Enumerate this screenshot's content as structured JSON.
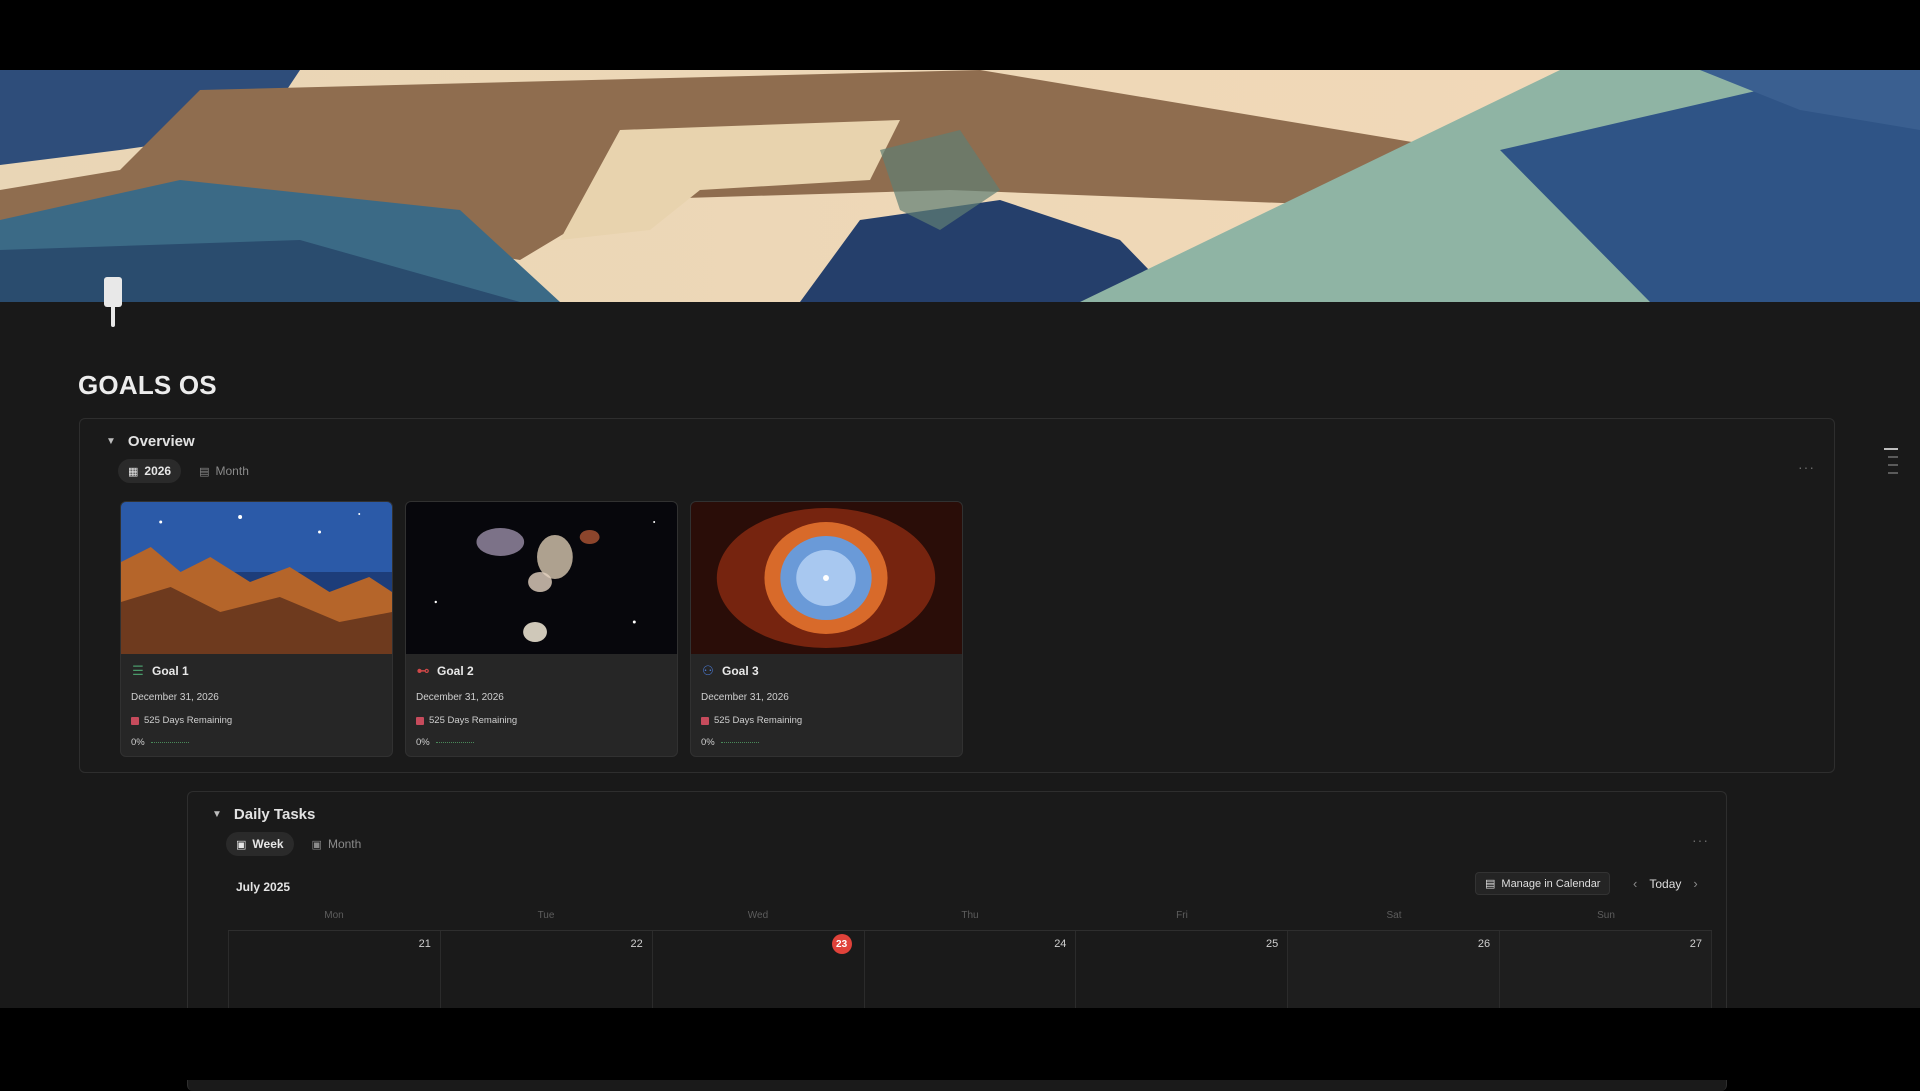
{
  "page": {
    "title": "GOALS OS"
  },
  "overview": {
    "heading": "Overview",
    "views": [
      {
        "label": "2026",
        "icon": "grid-icon",
        "active": true
      },
      {
        "label": "Month",
        "icon": "calendar-icon",
        "active": false
      }
    ],
    "more": "···",
    "cards": [
      {
        "title": "Goal 1",
        "icon": "stack-icon",
        "date": "December 31, 2026",
        "remaining": "525 Days Remaining",
        "progress": "0%"
      },
      {
        "title": "Goal 2",
        "icon": "dumbbell-icon",
        "date": "December 31, 2026",
        "remaining": "525 Days Remaining",
        "progress": "0%"
      },
      {
        "title": "Goal 3",
        "icon": "people-icon",
        "date": "December 31, 2026",
        "remaining": "525 Days Remaining",
        "progress": "0%"
      }
    ]
  },
  "daily": {
    "heading": "Daily Tasks",
    "views": [
      {
        "label": "Week",
        "active": true
      },
      {
        "label": "Month",
        "active": false
      }
    ],
    "more": "···",
    "month_label": "July 2025",
    "manage_label": "Manage in Calendar",
    "today_label": "Today",
    "prev_glyph": "‹",
    "next_glyph": "›",
    "day_names": [
      "Mon",
      "Tue",
      "Wed",
      "Thu",
      "Fri",
      "Sat",
      "Sun"
    ],
    "dates": [
      "21",
      "22",
      "23",
      "24",
      "25",
      "26",
      "27"
    ],
    "today_index": 2
  },
  "help": {
    "glyph": "?"
  },
  "colors": {
    "accent_today": "#e0423a",
    "cal_icon": "#c64b5c",
    "goal1_icon": "#4a9a6a",
    "goal2_icon": "#d04848",
    "goal3_icon": "#4a78d0"
  }
}
